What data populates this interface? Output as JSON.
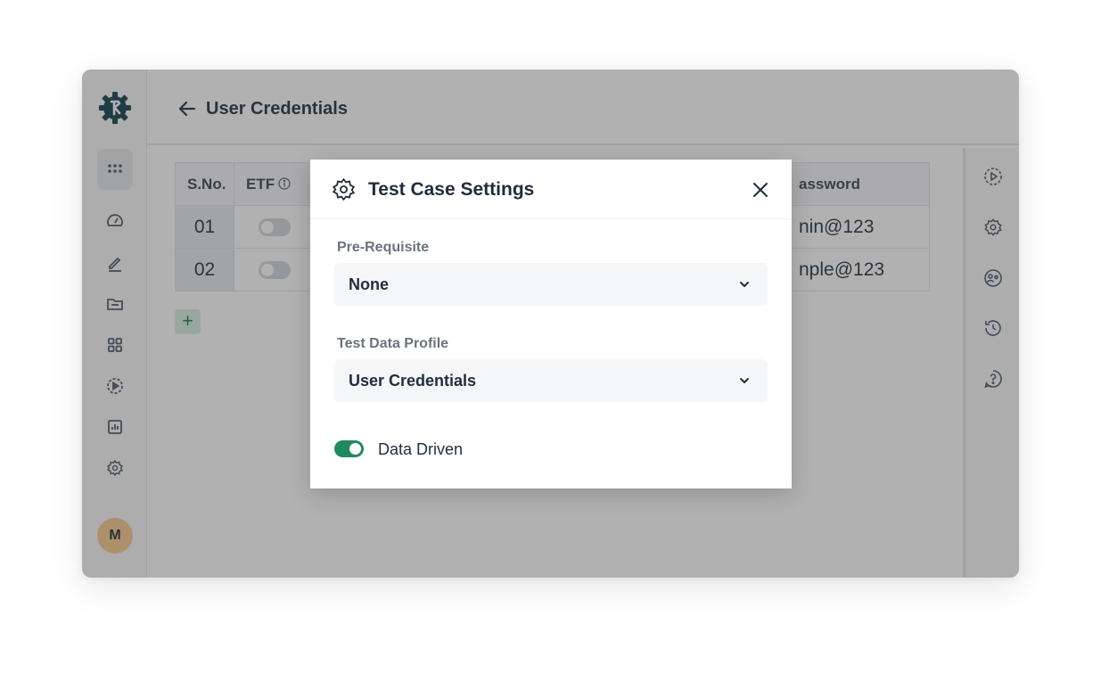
{
  "header": {
    "title": "User Credentials"
  },
  "sidebar": {
    "avatar_initial": "M",
    "items": [
      {
        "icon": "apps-grid-icon"
      },
      {
        "icon": "dashboard-gauge-icon"
      },
      {
        "icon": "edit-pen-icon"
      },
      {
        "icon": "folder-icon"
      },
      {
        "icon": "modules-grid-icon"
      },
      {
        "icon": "run-play-icon"
      },
      {
        "icon": "reports-chart-icon"
      },
      {
        "icon": "settings-gear-icon"
      }
    ]
  },
  "table": {
    "columns": [
      "S.No.",
      "ETF",
      "assword"
    ],
    "rows": [
      {
        "sno": "01",
        "password": "nin@123"
      },
      {
        "sno": "02",
        "password": "nple@123"
      }
    ]
  },
  "modal": {
    "title": "Test Case Settings",
    "prerequisite_label": "Pre-Requisite",
    "prerequisite_value": "None",
    "profile_label": "Test Data Profile",
    "profile_value": "User Credentials",
    "data_driven_label": "Data Driven",
    "data_driven_enabled": true
  },
  "colors": {
    "accent_green": "#1f8a5b",
    "logo_dark": "#0f3d4a",
    "avatar_bg": "#f9c78d"
  }
}
